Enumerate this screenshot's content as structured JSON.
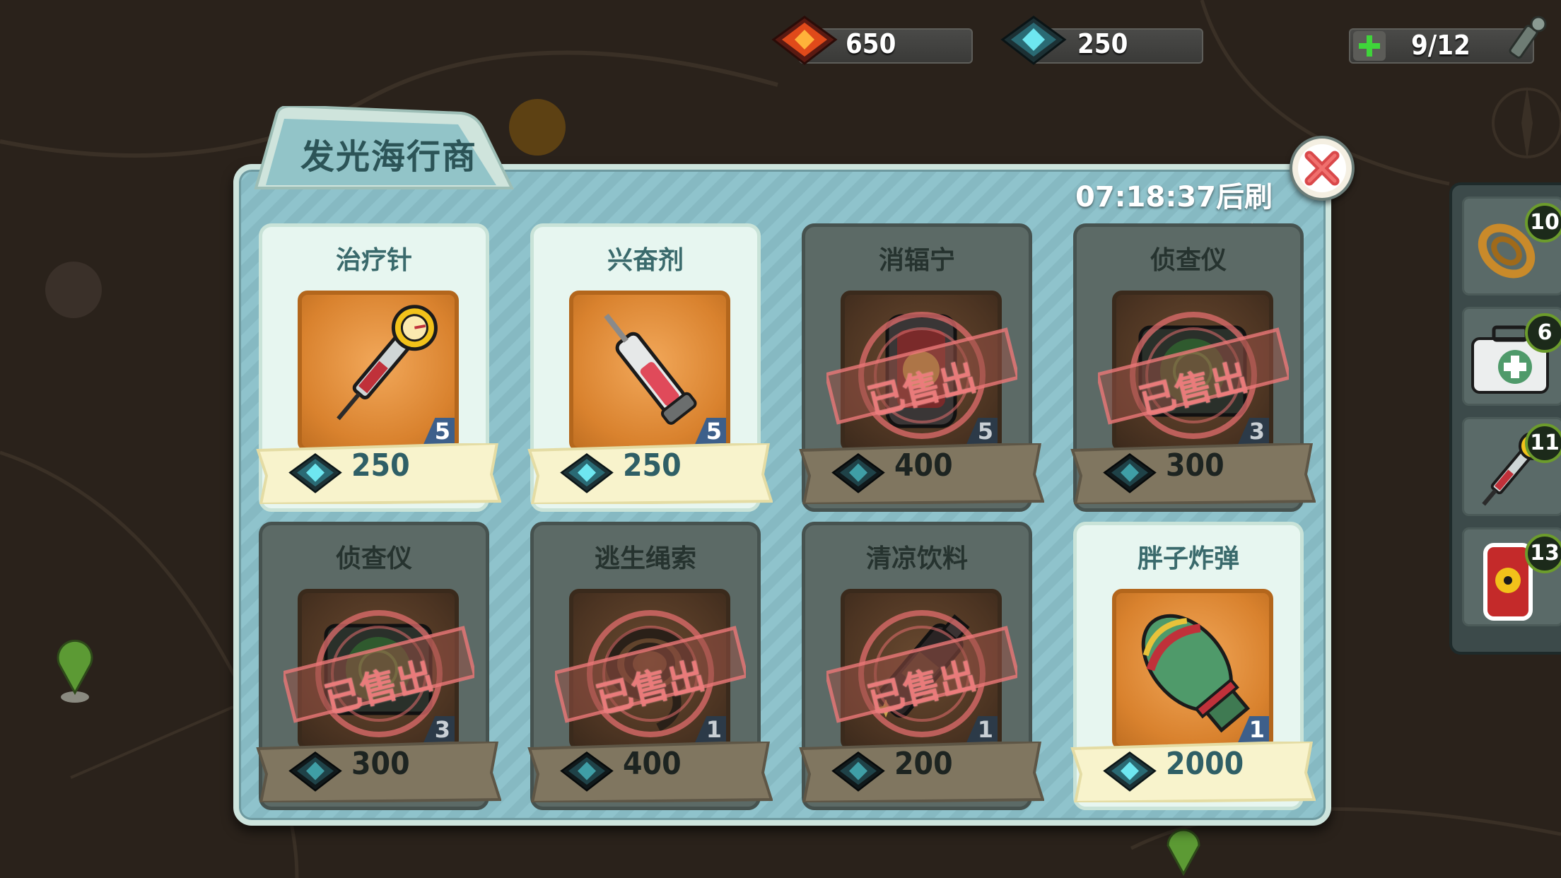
{
  "hud": {
    "caps_value": "650",
    "chips_value": "250",
    "action_points": "9/12"
  },
  "shop": {
    "title": "发光海行商",
    "refresh_text": "07:18:37后刷新",
    "sold_label": "已售出",
    "items": [
      {
        "name": "治疗针",
        "qty": "5",
        "price": "250",
        "sold": false,
        "icon": "stimpak-icon"
      },
      {
        "name": "兴奋剂",
        "qty": "5",
        "price": "250",
        "sold": false,
        "icon": "psycho-syringe-icon"
      },
      {
        "name": "消辐宁",
        "qty": "5",
        "price": "400",
        "sold": true,
        "icon": "radaway-icon"
      },
      {
        "name": "侦查仪",
        "qty": "3",
        "price": "300",
        "sold": true,
        "icon": "radar-device-icon"
      },
      {
        "name": "侦查仪",
        "qty": "3",
        "price": "300",
        "sold": true,
        "icon": "radar-device-icon"
      },
      {
        "name": "逃生绳索",
        "qty": "1",
        "price": "400",
        "sold": true,
        "icon": "escape-rope-icon"
      },
      {
        "name": "清凉饮料",
        "qty": "1",
        "price": "200",
        "sold": true,
        "icon": "cool-drink-icon"
      },
      {
        "name": "胖子炸弹",
        "qty": "1",
        "price": "2000",
        "sold": false,
        "icon": "mini-nuke-icon"
      }
    ]
  },
  "inventory": [
    {
      "count": "10",
      "icon": "rope-icon"
    },
    {
      "count": "6",
      "icon": "medkit-icon"
    },
    {
      "count": "11",
      "icon": "stimpak-icon"
    },
    {
      "count": "13",
      "icon": "radaway-bag-icon"
    }
  ],
  "colors": {
    "panel": "#8fc3cc",
    "card_available": "#e7f6f0",
    "card_sold": "#5c6a66",
    "icon_orange": "#e08a34",
    "stamp_red": "#e06a6a",
    "price_text": "#2f5f66"
  }
}
